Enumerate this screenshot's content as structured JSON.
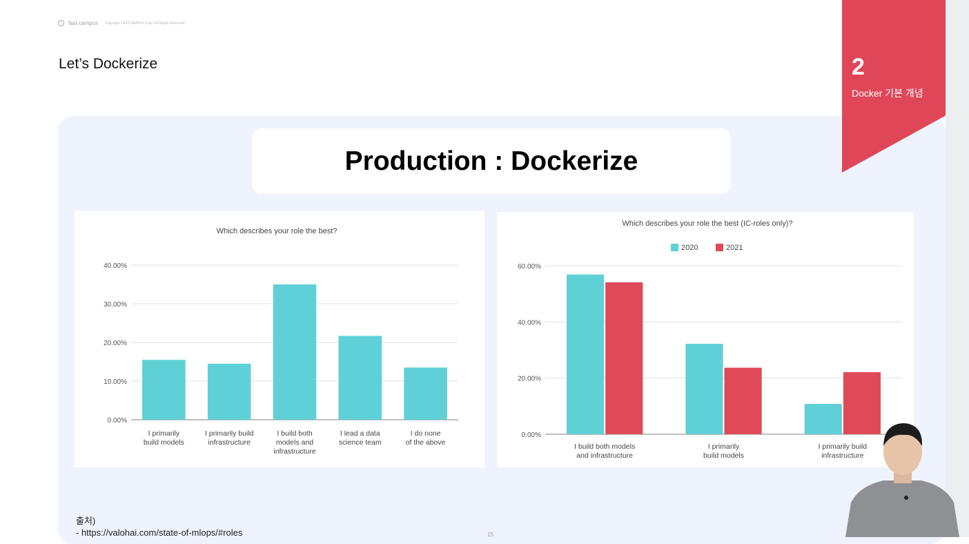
{
  "header": {
    "brand": "fast campus",
    "copyright": "Copyright FASTCAMPUS Corp. All Rights Reserved",
    "slide_title": "Let’s Dockerize"
  },
  "ribbon": {
    "number": "2",
    "subtitle": "Docker 기본 개념",
    "color": "#df4758"
  },
  "main": {
    "title": "Production : Dockerize"
  },
  "source": {
    "label": "출처)",
    "url": "- https://valohai.com/state-of-mlops/#roles"
  },
  "page_number": "15",
  "colors": {
    "teal": "#5fd1d6",
    "red": "#e04a58",
    "panel": "#eef3fd"
  },
  "chart_data": [
    {
      "type": "bar",
      "title": "Which describes your role the best?",
      "categories": [
        [
          "I primarily",
          "build models"
        ],
        [
          "I primarily build",
          "infrastructure"
        ],
        [
          "I build both",
          "models and",
          "infrastructure"
        ],
        [
          "I lead a data",
          "science team"
        ],
        [
          "I do none",
          "of the above"
        ]
      ],
      "series": [
        {
          "values": [
            15.5,
            14.5,
            35,
            21.7,
            13.5
          ],
          "color": "#5fd1d6"
        }
      ],
      "ylim": [
        0,
        40
      ],
      "yticks": [
        "0.00%",
        "10.00%",
        "20.00%",
        "30.00%",
        "40.00%"
      ],
      "grid": true
    },
    {
      "type": "bar",
      "title": "Which describes your role the best (IC-roles only)?",
      "categories": [
        [
          "I build both models",
          "and infrastructure"
        ],
        [
          "I primarily",
          "build models"
        ],
        [
          "I primarily build",
          "infrastructure"
        ]
      ],
      "series": [
        {
          "name": "2020",
          "values": [
            56.9,
            32.2,
            10.8
          ],
          "color": "#5fd1d6"
        },
        {
          "name": "2021",
          "values": [
            54.1,
            23.7,
            22.1
          ],
          "color": "#e04a58"
        }
      ],
      "ylim": [
        0,
        60
      ],
      "yticks": [
        "0.00%",
        "20.00%",
        "40.00%",
        "60.00%"
      ],
      "legend": "top",
      "grid": true
    }
  ]
}
